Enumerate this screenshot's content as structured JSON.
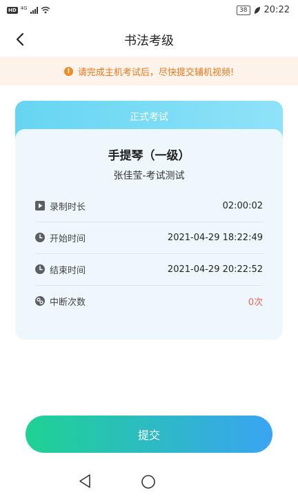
{
  "status_bar": {
    "hd": "HD",
    "network": "4G",
    "battery": "38",
    "time": "20:22"
  },
  "header": {
    "title": "书法考级"
  },
  "notice": {
    "text": "请完成主机考试后，尽快提交辅机视频!"
  },
  "card": {
    "header_label": "正式考试",
    "exam_title": "手提琴（一级）",
    "examinee": "张佳莹-考试测试",
    "rows": [
      {
        "label": "录制时长",
        "value": "02:00:02",
        "icon": "play-icon"
      },
      {
        "label": "开始时间",
        "value": "2021-04-29 18:22:49",
        "icon": "clock-icon"
      },
      {
        "label": "结束时间",
        "value": "2021-04-29 20:22:52",
        "icon": "clock-icon"
      },
      {
        "label": "中断次数",
        "value": "0次",
        "icon": "interrupt-icon"
      }
    ]
  },
  "submit": {
    "label": "提交"
  },
  "colors": {
    "accent_orange": "#f08a24",
    "card_header": "#7fdcf6",
    "submit_start": "#1ed293",
    "submit_end": "#3aa4f2",
    "interrupt_value": "#f0645a"
  }
}
